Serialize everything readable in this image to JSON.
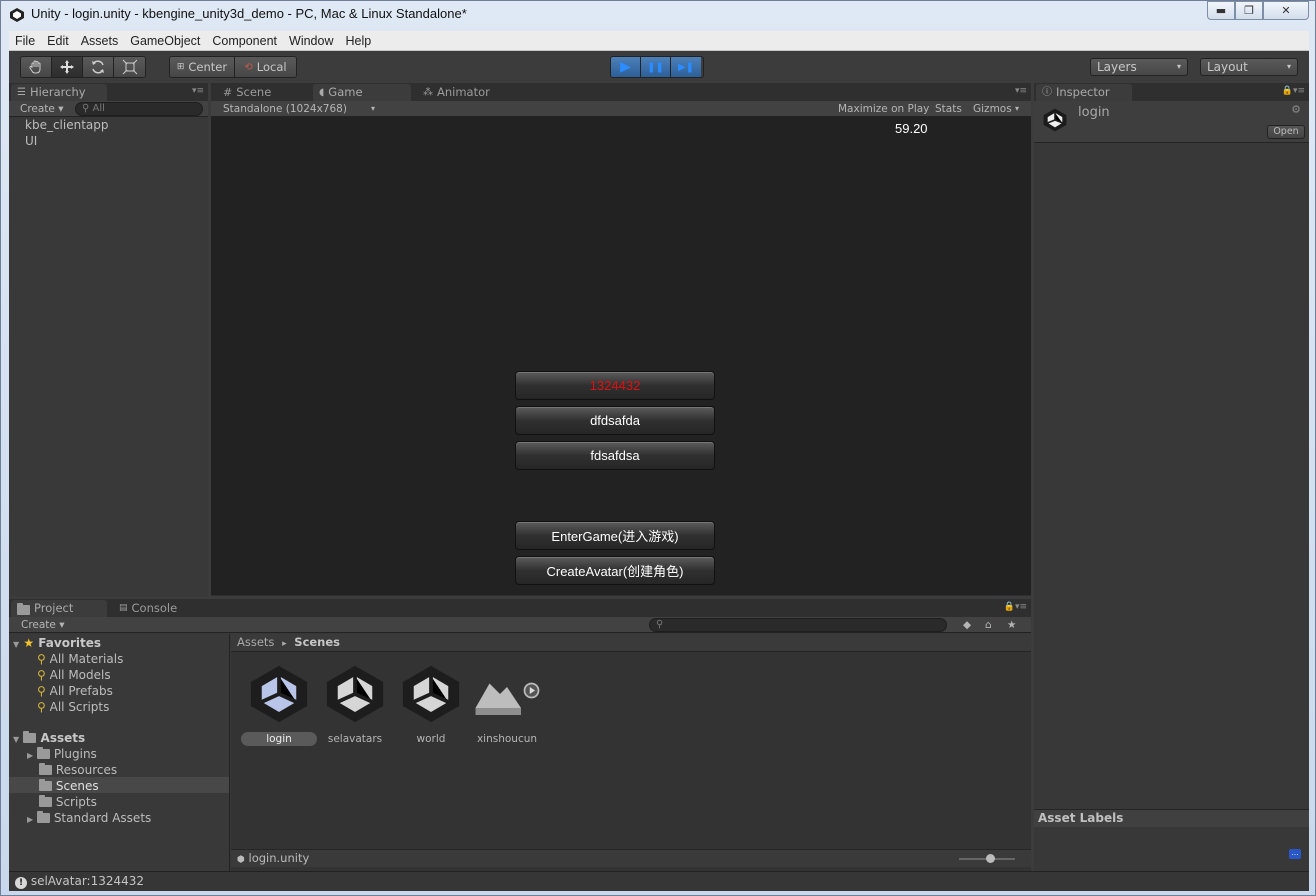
{
  "window": {
    "title": "Unity - login.unity - kbengine_unity3d_demo - PC, Mac & Linux Standalone*",
    "min_glyph": "▬",
    "max_glyph": "❐",
    "close_glyph": "✕"
  },
  "menu": [
    "File",
    "Edit",
    "Assets",
    "GameObject",
    "Component",
    "Window",
    "Help"
  ],
  "toolbar": {
    "pivot_label": "Center",
    "space_label": "Local",
    "layers_label": "Layers",
    "layout_label": "Layout",
    "play_glyph": "▶",
    "pause_glyph": "❚❚",
    "step_glyph": "▶❚"
  },
  "hierarchy": {
    "tab_label": "Hierarchy",
    "create_label": "Create ▾",
    "search_placeholder": "All",
    "items": [
      "kbe_clientapp",
      "UI"
    ]
  },
  "center_tabs": {
    "scene_label": "Scene",
    "game_label": "Game",
    "animator_label": "Animator"
  },
  "game": {
    "resolution": "Standalone (1024x768)",
    "maximize_label": "Maximize on Play",
    "stats_label": "Stats",
    "gizmos_label": "Gizmos",
    "fps": "59.20",
    "avatar_buttons": [
      "1324432",
      "dfdsafda",
      "fdsafdsa"
    ],
    "selected_color": "#e01010",
    "enter_label": "EnterGame(进入游戏)",
    "create_label": "CreateAvatar(创建角色)"
  },
  "inspector": {
    "tab_label": "Inspector",
    "object_name": "login",
    "open_label": "Open",
    "asset_labels": "Asset Labels"
  },
  "project": {
    "tab_label": "Project",
    "console_label": "Console",
    "create_label": "Create ▾",
    "favorites_label": "Favorites",
    "favorites": [
      "All Materials",
      "All Models",
      "All Prefabs",
      "All Scripts"
    ],
    "assets_label": "Assets",
    "folders": [
      "Plugins",
      "Resources",
      "Scenes",
      "Scripts",
      "Standard Assets"
    ],
    "selected_folder": "Scenes",
    "breadcrumb_root": "Assets",
    "breadcrumb_sep": "▸",
    "breadcrumb_current": "Scenes",
    "assets": [
      "login",
      "selavatars",
      "world",
      "xinshoucun"
    ],
    "footer_path": "login.unity"
  },
  "status": {
    "message": "selAvatar:1324432"
  }
}
